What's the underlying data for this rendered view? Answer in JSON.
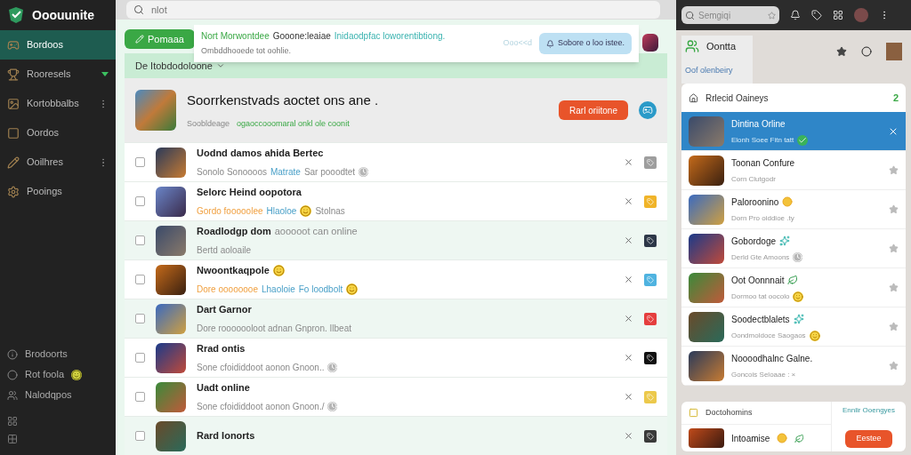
{
  "app": {
    "name": "Ooouunite"
  },
  "sidebar": {
    "items": [
      {
        "label": "Bordoos",
        "selected": true,
        "kind": "plain"
      },
      {
        "label": "Rooresels",
        "selected": false,
        "kind": "badge"
      },
      {
        "label": "Kortobbalbs",
        "selected": false,
        "kind": "dots"
      },
      {
        "label": "Oordos",
        "selected": false,
        "kind": "plain"
      },
      {
        "label": "Ooilhres",
        "selected": false,
        "kind": "dots"
      },
      {
        "label": "Pooings",
        "selected": false,
        "kind": "plain"
      }
    ],
    "bottom_items": [
      {
        "label": "Brodoorts",
        "kind": "plain"
      },
      {
        "label": "Rot foola",
        "kind": "badge"
      },
      {
        "label": "Nalodqpos",
        "kind": "plain"
      }
    ]
  },
  "search": {
    "value": "nlot"
  },
  "top_right": {
    "search": {
      "placeholder": "Semgiqi"
    }
  },
  "new_button": {
    "label": "Pomaaa"
  },
  "popup": {
    "title": [
      {
        "text": "Nort Morwontdee",
        "kind": "green"
      },
      {
        "text": "Gooone:leaiae",
        "kind": "plain"
      },
      {
        "text": "Inidaodpfac loworentibtiong.",
        "kind": "teal"
      }
    ],
    "subtitle": "Ombddhooede tot oohlie.",
    "hint": "Ooo<<d",
    "action": "Sobore o loo istee."
  },
  "filter": {
    "label": "De Itobdodoloone"
  },
  "header": {
    "title": "Soorrkenstvads aoctet ons ane .",
    "meta": "Soobldeage",
    "meta_link": "ogaoccooomaral onkl ole coonit",
    "button": "Rarl oriitone"
  },
  "rows": [
    {
      "checked": false,
      "highlighted": false,
      "color": "#9e9e9e",
      "title": [
        {
          "text": "Uodnd damos ahida Bertec",
          "kind": "text"
        }
      ],
      "subtitle": [
        {
          "text": "Sonolo Sonoooos",
          "kind": "muted"
        },
        {
          "text": "Matrate",
          "kind": "blue"
        },
        {
          "text": "Sar pooodtet",
          "kind": "muted"
        },
        {
          "kind": "clock"
        }
      ]
    },
    {
      "checked": false,
      "highlighted": false,
      "color": "#f0b429",
      "title": [
        {
          "text": "Selorc Heind oopotora",
          "kind": "text"
        }
      ],
      "subtitle": [
        {
          "text": "Gordo fooooolee",
          "kind": "orange"
        },
        {
          "text": "Hlaoloe",
          "kind": "blue"
        },
        {
          "kind": "emoji"
        },
        {
          "text": "Stolnas",
          "kind": "muted"
        }
      ]
    },
    {
      "checked": false,
      "highlighted": true,
      "color": "#2d3748",
      "title": [
        {
          "text": "Roadlodgp dom",
          "kind": "text"
        },
        {
          "text": "aooooot can online",
          "kind": "muted"
        }
      ],
      "subtitle": [
        {
          "text": "Bertd aoloaile",
          "kind": "muted"
        }
      ]
    },
    {
      "checked": false,
      "highlighted": false,
      "color": "#4fb3e0",
      "title": [
        {
          "text": "Nwoontkaqpole",
          "kind": "text"
        },
        {
          "kind": "emoji"
        }
      ],
      "subtitle": [
        {
          "text": "Dore oooooooe",
          "kind": "orange"
        },
        {
          "text": "Lhaoloie",
          "kind": "blue"
        },
        {
          "text": "Fo loodbolt",
          "kind": "blue"
        },
        {
          "kind": "emoji"
        }
      ]
    },
    {
      "checked": false,
      "highlighted": true,
      "color": "#e53e3e",
      "title": [
        {
          "text": "Dart Garnor",
          "kind": "text"
        }
      ],
      "subtitle": [
        {
          "text": "Dore rooooooloot adnan Gnpron. Ilbeat",
          "kind": "muted"
        }
      ]
    },
    {
      "checked": false,
      "highlighted": false,
      "color": "#111111",
      "title": [
        {
          "text": "Rrad ontis",
          "kind": "text"
        }
      ],
      "subtitle": [
        {
          "text": "Sone cfoididdoot aonon Gnoon..",
          "kind": "muted"
        },
        {
          "kind": "clock"
        }
      ]
    },
    {
      "checked": false,
      "highlighted": false,
      "color": "#ecc94b",
      "title": [
        {
          "text": "Uadt online",
          "kind": "text"
        }
      ],
      "subtitle": [
        {
          "text": "Sone cfoididdoot aonon Gnoon./",
          "kind": "muted"
        },
        {
          "kind": "clock"
        }
      ]
    },
    {
      "checked": false,
      "highlighted": true,
      "color": "#3a3a3a",
      "title": [
        {
          "text": "Rard Ionorts",
          "kind": "text"
        }
      ]
    }
  ],
  "profile": {
    "name": "Oontta",
    "link": "Oof olenbeiry"
  },
  "recent": {
    "title": "Rrlecid Oaineys",
    "count": "2",
    "items": [
      {
        "selected": true,
        "title": "Dintina Orline",
        "subtitle": "Elonh Soee Fitn tatt",
        "subtitle_icon": {
          "kind": "check"
        }
      },
      {
        "selected": false,
        "title": "Toonan Confure",
        "subtitle": "Corn Clutgodr"
      },
      {
        "selected": false,
        "title": "Paloroonino",
        "title_icon": {
          "kind": "coin"
        },
        "subtitle": "Dorn Pro oiddioe .ty"
      },
      {
        "selected": false,
        "title": "Gobordoge",
        "title_icon": {
          "kind": "sparkle"
        },
        "subtitle": "Derld Gte Amoons",
        "subtitle_icon": {
          "kind": "clock"
        }
      },
      {
        "selected": false,
        "title": "Oot Oonnnait",
        "title_icon": {
          "kind": "leaf"
        },
        "subtitle": "Dormoo tat oocolo",
        "subtitle_icon": {
          "kind": "emoji"
        }
      },
      {
        "selected": false,
        "title": "Soodectblalets",
        "title_icon": {
          "kind": "sparkle"
        },
        "subtitle": "Oondmoldoce Saogaos",
        "subtitle_icon": {
          "kind": "emoji"
        }
      },
      {
        "selected": false,
        "title": "Noooodhalnc Galne.",
        "subtitle": "Goncois Seloaae : ×"
      }
    ]
  },
  "bottom_card": {
    "title": "Doctohomins",
    "link": "Ennlir Ooengyes",
    "item": "Intoamise",
    "button": "Eestee"
  }
}
